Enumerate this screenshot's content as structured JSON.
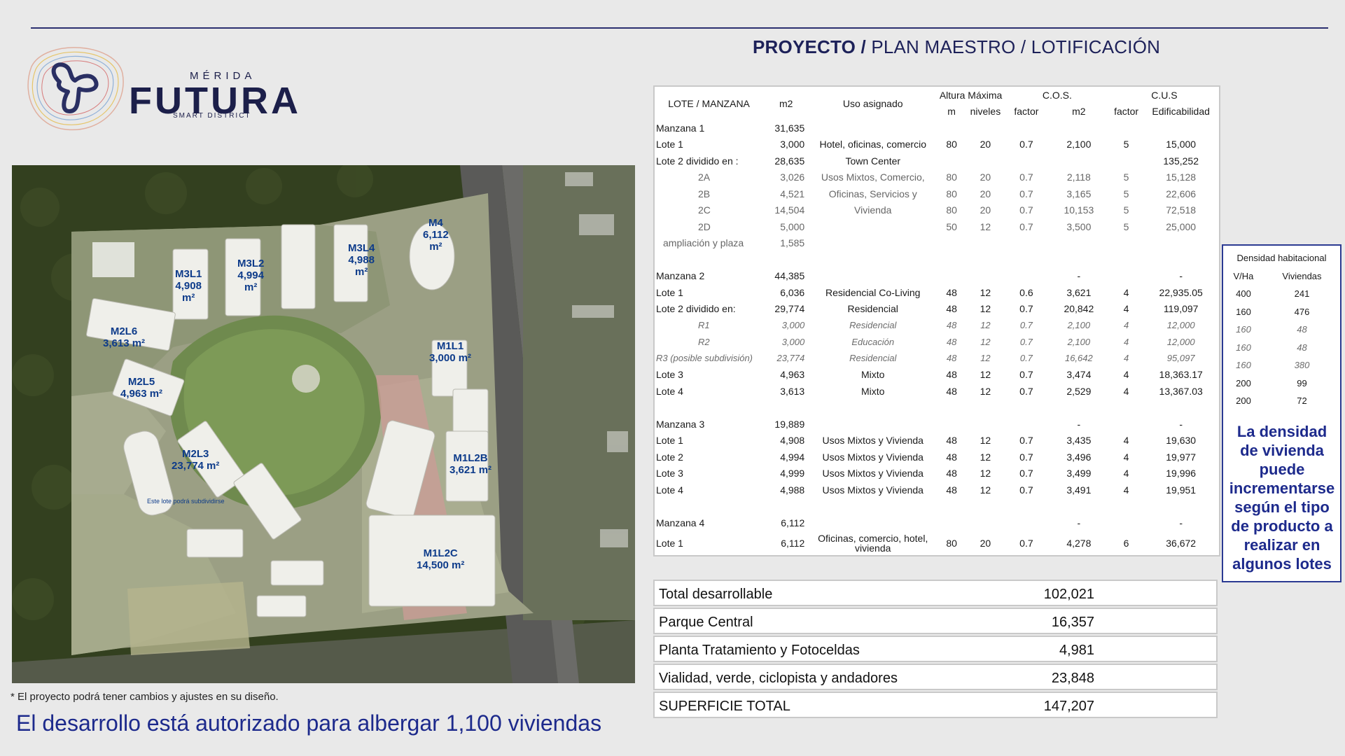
{
  "brand": {
    "top": "MÉRIDA",
    "name": "FUTURA",
    "tagline": "SMART DISTRICT"
  },
  "title": {
    "bold": "PROYECTO /",
    "rest": " PLAN MAESTRO / LOTIFICACIÓN"
  },
  "map_labels": [
    {
      "id": "M3L1",
      "text": "M3L1\n4,908\nm²"
    },
    {
      "id": "M3L2",
      "text": "M3L2\n4,994\nm²"
    },
    {
      "id": "M3L4",
      "text": "M3L4\n4,988\nm²"
    },
    {
      "id": "M4",
      "text": "M4\n6,112\nm²"
    },
    {
      "id": "M2L6",
      "text": "M2L6\n3,613 m²"
    },
    {
      "id": "M2L5",
      "text": "M2L5\n4,963 m²"
    },
    {
      "id": "M1L1",
      "text": "M1L1\n3,000 m²"
    },
    {
      "id": "M1L2B",
      "text": "M1L2B\n3,621 m²"
    },
    {
      "id": "M2L3",
      "text": "M2L3\n23,774 m²"
    },
    {
      "id": "M2L3note",
      "text": "Este lote podrá subdividirse"
    },
    {
      "id": "M1L2C",
      "text": "M1L2C\n14,500 m²"
    }
  ],
  "footnote": "* El proyecto podrá tener cambios y ajustes en su diseño.",
  "headline": "El desarrollo está autorizado para albergar 1,100 viviendas",
  "table": {
    "header_top": {
      "altura": "Altura Máxima",
      "cos": "C.O.S.",
      "cus": "C.U.S"
    },
    "header": [
      "LOTE / MANZANA",
      "m2",
      "Uso asignado",
      "m",
      "niveles",
      "factor",
      "m2",
      "factor",
      "Edificabilidad"
    ],
    "rows": [
      {
        "cells": [
          "Manzana 1",
          "31,635",
          "",
          "",
          "",
          "",
          "",
          "",
          ""
        ]
      },
      {
        "cells": [
          "Lote 1",
          "3,000",
          "Hotel, oficinas, comercio",
          "80",
          "20",
          "0.7",
          "2,100",
          "5",
          "15,000"
        ]
      },
      {
        "cells": [
          "Lote 2 dividido en :",
          "28,635",
          "Town Center",
          "",
          "",
          "",
          "",
          "",
          "135,252"
        ]
      },
      {
        "cells": [
          "2A",
          "3,026",
          "Usos Mixtos, Comercio,",
          "80",
          "20",
          "0.7",
          "2,118",
          "5",
          "15,128"
        ],
        "indent": true,
        "gray": true
      },
      {
        "cells": [
          "2B",
          "4,521",
          "Oficinas, Servicios y",
          "80",
          "20",
          "0.7",
          "3,165",
          "5",
          "22,606"
        ],
        "indent": true,
        "gray": true
      },
      {
        "cells": [
          "2C",
          "14,504",
          "Vivienda",
          "80",
          "20",
          "0.7",
          "10,153",
          "5",
          "72,518"
        ],
        "indent": true,
        "gray": true
      },
      {
        "cells": [
          "2D",
          "5,000",
          "",
          "50",
          "12",
          "0.7",
          "3,500",
          "5",
          "25,000"
        ],
        "indent": true,
        "gray": true
      },
      {
        "cells": [
          "ampliación y plaza",
          "1,585",
          "",
          "",
          "",
          "",
          "",
          "",
          ""
        ],
        "indent": true,
        "gray": true
      },
      {
        "cells": [
          "",
          "",
          "",
          "",
          "",
          "",
          "",
          "",
          ""
        ]
      },
      {
        "cells": [
          "Manzana 2",
          "44,385",
          "",
          "",
          "",
          "",
          "-",
          "",
          "-"
        ]
      },
      {
        "cells": [
          "Lote 1",
          "6,036",
          "Residencial Co-Living",
          "48",
          "12",
          "0.6",
          "3,621",
          "4",
          "22,935.05"
        ]
      },
      {
        "cells": [
          "Lote 2 dividido en:",
          "29,774",
          "Residencial",
          "48",
          "12",
          "0.7",
          "20,842",
          "4",
          "119,097"
        ]
      },
      {
        "cells": [
          "R1",
          "3,000",
          "Residencial",
          "48",
          "12",
          "0.7",
          "2,100",
          "4",
          "12,000"
        ],
        "italic": true,
        "indent": true
      },
      {
        "cells": [
          "R2",
          "3,000",
          "Educación",
          "48",
          "12",
          "0.7",
          "2,100",
          "4",
          "12,000"
        ],
        "italic": true,
        "indent": true
      },
      {
        "cells": [
          "R3 (posible subdivisión)",
          "23,774",
          "Residencial",
          "48",
          "12",
          "0.7",
          "16,642",
          "4",
          "95,097"
        ],
        "italic": true
      },
      {
        "cells": [
          "Lote 3",
          "4,963",
          "Mixto",
          "48",
          "12",
          "0.7",
          "3,474",
          "4",
          "18,363.17"
        ]
      },
      {
        "cells": [
          "Lote 4",
          "3,613",
          "Mixto",
          "48",
          "12",
          "0.7",
          "2,529",
          "4",
          "13,367.03"
        ]
      },
      {
        "cells": [
          "",
          "",
          "",
          "",
          "",
          "",
          "",
          "",
          ""
        ]
      },
      {
        "cells": [
          "Manzana 3",
          "19,889",
          "",
          "",
          "",
          "",
          "-",
          "",
          "-"
        ]
      },
      {
        "cells": [
          "Lote 1",
          "4,908",
          "Usos Mixtos y Vivienda",
          "48",
          "12",
          "0.7",
          "3,435",
          "4",
          "19,630"
        ]
      },
      {
        "cells": [
          "Lote 2",
          "4,994",
          "Usos Mixtos y Vivienda",
          "48",
          "12",
          "0.7",
          "3,496",
          "4",
          "19,977"
        ]
      },
      {
        "cells": [
          "Lote 3",
          "4,999",
          "Usos Mixtos y Vivienda",
          "48",
          "12",
          "0.7",
          "3,499",
          "4",
          "19,996"
        ]
      },
      {
        "cells": [
          "Lote 4",
          "4,988",
          "Usos Mixtos y Vivienda",
          "48",
          "12",
          "0.7",
          "3,491",
          "4",
          "19,951"
        ]
      },
      {
        "cells": [
          "",
          "",
          "",
          "",
          "",
          "",
          "",
          "",
          ""
        ]
      },
      {
        "cells": [
          "Manzana 4",
          "6,112",
          "",
          "",
          "",
          "",
          "-",
          "",
          "-"
        ]
      },
      {
        "cells": [
          "Lote 1",
          "6,112",
          "Oficinas, comercio, hotel, vivienda",
          "80",
          "20",
          "0.7",
          "4,278",
          "6",
          "36,672"
        ],
        "tall": true
      }
    ]
  },
  "summary": [
    {
      "label": "Total desarrollable",
      "value": "102,021"
    },
    {
      "label": "Parque Central",
      "value": "16,357"
    },
    {
      "label": "Planta Tratamiento y Fotoceldas",
      "value": "4,981"
    },
    {
      "label": "Vialidad, verde, ciclopista y andadores",
      "value": "23,848"
    },
    {
      "label": "SUPERFICIE TOTAL",
      "value": "147,207"
    }
  ],
  "density": {
    "title": "Densidad habitacional",
    "header": [
      "V/Ha",
      "Viviendas"
    ],
    "rows": [
      {
        "cells": [
          "400",
          "241"
        ]
      },
      {
        "cells": [
          "160",
          "476"
        ]
      },
      {
        "cells": [
          "160",
          "48"
        ],
        "italic": true
      },
      {
        "cells": [
          "160",
          "48"
        ],
        "italic": true
      },
      {
        "cells": [
          "160",
          "380"
        ],
        "italic": true
      },
      {
        "cells": [
          "200",
          "99"
        ]
      },
      {
        "cells": [
          "200",
          "72"
        ]
      }
    ],
    "note": "La densidad de vivienda puede incrementarse según el tipo de producto a realizar en algunos lotes"
  }
}
